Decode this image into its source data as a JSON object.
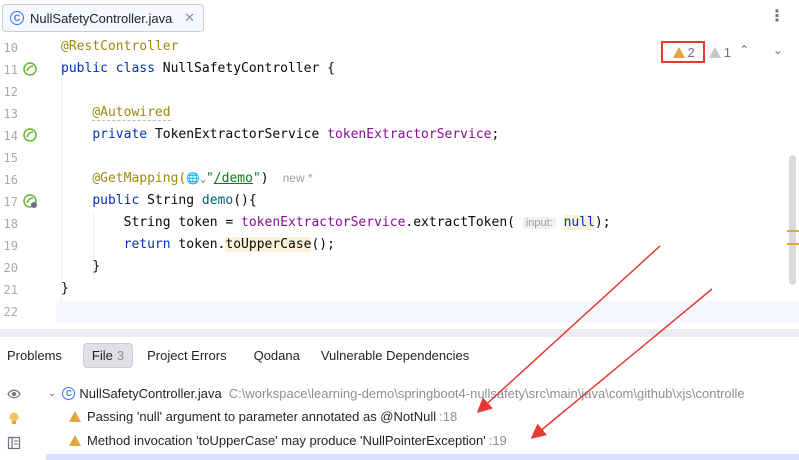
{
  "tab": {
    "icon": "class-c-icon",
    "icon_glyph": "C",
    "label": "NullSafetyController.java",
    "close": "✕"
  },
  "more_menu": "⋮",
  "inspection": {
    "warnings": "2",
    "weak_warnings": "1",
    "nav": "⌃ ⌄"
  },
  "lines": [
    {
      "n": "10"
    },
    {
      "n": "11"
    },
    {
      "n": "12"
    },
    {
      "n": "13"
    },
    {
      "n": "14"
    },
    {
      "n": "15"
    },
    {
      "n": "16"
    },
    {
      "n": "17"
    },
    {
      "n": "18"
    },
    {
      "n": "19"
    },
    {
      "n": "20"
    },
    {
      "n": "21"
    },
    {
      "n": "22"
    }
  ],
  "code": {
    "l10_ann": "@RestController",
    "l11_kw": "public class ",
    "l11_name": "NullSafetyController {",
    "l13_ann": "@Autowired",
    "l14_kw": "private ",
    "l14_type": "TokenExtractorService ",
    "l14_fld": "tokenExtractorService",
    "l14_end": ";",
    "l16_ann": "@GetMapping(",
    "l16_globe": "🌐",
    "l16_chev": "⌄",
    "l16_q1": "\"",
    "l16_str": "/demo",
    "l16_q2": "\"",
    "l16_end": ")",
    "l16_hint": "new *",
    "l17_kw": "public ",
    "l17_type": "String ",
    "l17_mth": "demo",
    "l17_end": "(){",
    "l18_a": "String token = ",
    "l18_fld": "tokenExtractorService",
    "l18_b": ".extractToken(",
    "l18_hint": "input:",
    "l18_null": "null",
    "l18_end": ");",
    "l19_kw": "return ",
    "l19_a": "token.",
    "l19_m": "toUpperCase",
    "l19_end": "();",
    "l20": "}",
    "l21": "}"
  },
  "problems": {
    "title": "Problems",
    "tabs": {
      "file": "File",
      "file_count": "3",
      "project_errors": "Project Errors",
      "qodana": "Qodana",
      "vulns": "Vulnerable Dependencies"
    },
    "file_row": {
      "name": "NullSafetyController.java",
      "path": "C:\\workspace\\learning-demo\\springboot4-nullsafety\\src\\main\\java\\com\\github\\xjs\\controlle"
    },
    "items": [
      {
        "text": "Passing 'null' argument to parameter annotated as @NotNull",
        "line": ":18"
      },
      {
        "text": "Method invocation 'toUpperCase' may produce 'NullPointerException'",
        "line": ":19"
      }
    ]
  },
  "colors": {
    "warning": "#e2a53a",
    "accent": "#3574f0",
    "annotation_arrow": "#e53935"
  }
}
